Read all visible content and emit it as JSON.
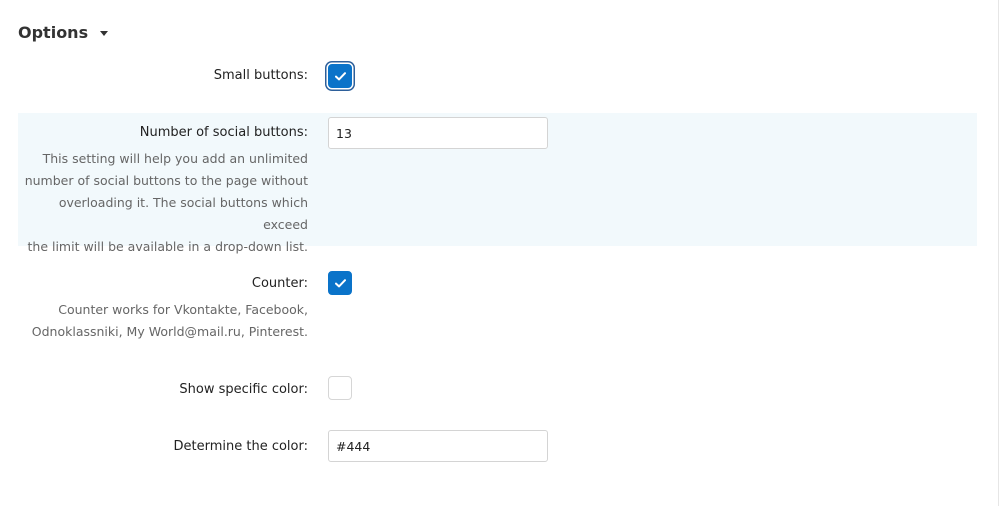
{
  "section": {
    "title": "Options"
  },
  "fields": {
    "small_buttons": {
      "label": "Small buttons:",
      "checked": true
    },
    "social_buttons": {
      "label": "Number of social buttons:",
      "value": "13",
      "description_lines": [
        "This setting will help you add an unlimited",
        "number of social buttons to the page without",
        "overloading it. The social buttons which exceed",
        "the limit will be available in a drop-down list."
      ]
    },
    "counter": {
      "label": "Counter:",
      "checked": true,
      "description_lines": [
        "Counter works for Vkontakte, Facebook,",
        "Odnoklassniki, My World@mail.ru, Pinterest."
      ]
    },
    "specific_color": {
      "label": "Show specific color:",
      "checked": false
    },
    "color": {
      "label": "Determine the color:",
      "value": "#444"
    }
  },
  "colors": {
    "accent": "#0a73c9",
    "highlight_bg": "#f2f9fc",
    "focus_ring": "#2d5f9a"
  },
  "icons": {
    "toggle": "caret-down-icon",
    "check": "checkmark-icon"
  }
}
